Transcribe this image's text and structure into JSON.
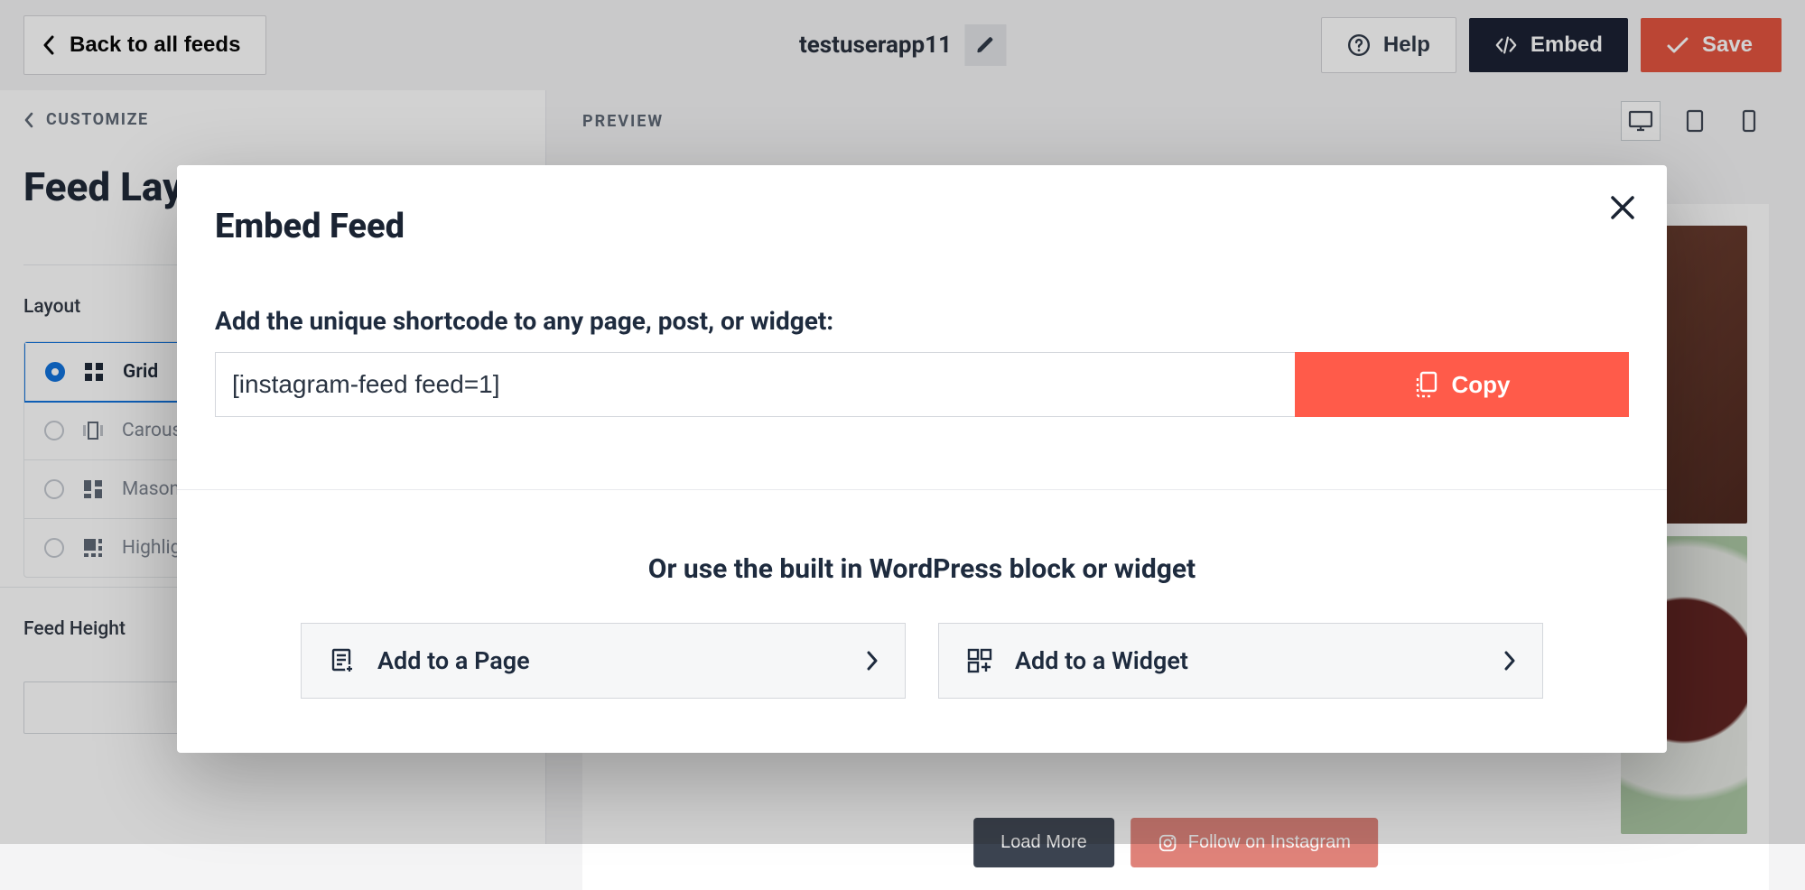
{
  "topbar": {
    "back_label": "Back to all feeds",
    "feed_title": "testuserapp11",
    "help_label": "Help",
    "embed_label": "Embed",
    "save_label": "Save"
  },
  "sidebar": {
    "customize_nav": "CUSTOMIZE",
    "title": "Feed Layout",
    "layout_label": "Layout",
    "options": {
      "grid": "Grid",
      "carousel": "Carousel",
      "masonry": "Masonry",
      "highlight": "Highlight"
    },
    "feed_height_label": "Feed Height",
    "feed_height_value": ""
  },
  "preview": {
    "label": "PREVIEW",
    "load_more": "Load More",
    "follow_ig": "Follow on Instagram"
  },
  "modal": {
    "title": "Embed Feed",
    "instruction": "Add the unique shortcode to any page, post, or widget:",
    "shortcode": "[instagram-feed feed=1]",
    "copy_label": "Copy",
    "or_heading": "Or use the built in WordPress block or widget",
    "add_page": "Add to a Page",
    "add_widget": "Add to a Widget"
  }
}
